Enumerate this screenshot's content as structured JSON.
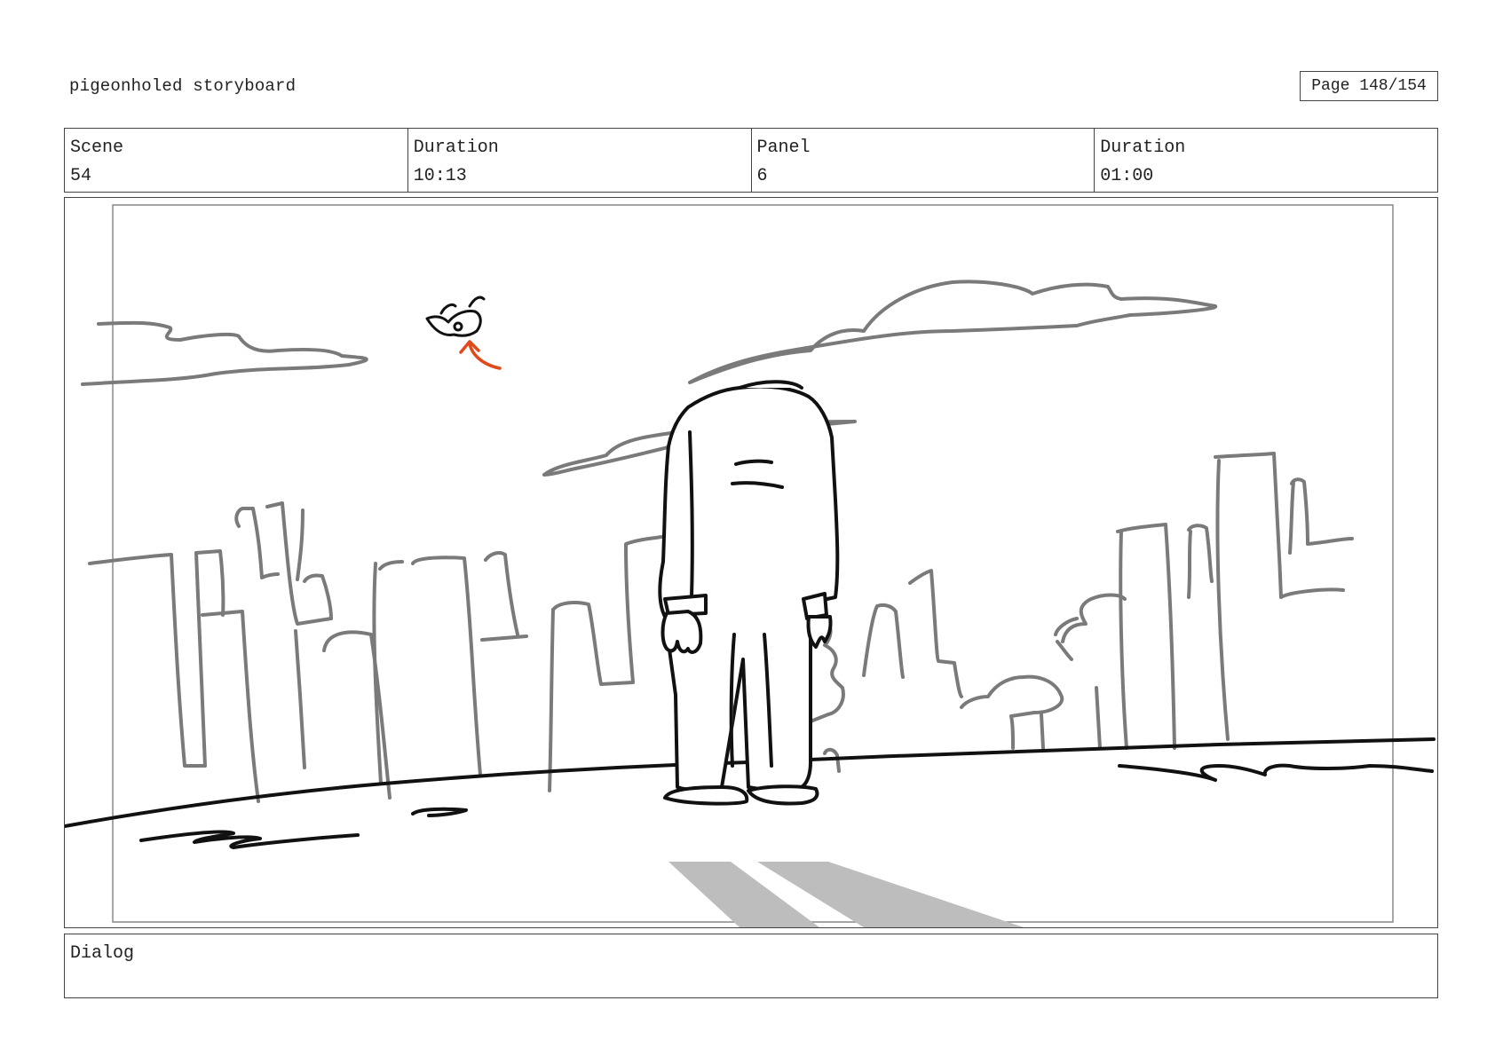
{
  "header": {
    "title": "pigeonholed storyboard",
    "page": "Page 148/154"
  },
  "meta": {
    "scene_label": "Scene",
    "scene_value": "54",
    "scene_duration_label": "Duration",
    "scene_duration_value": "10:13",
    "panel_label": "Panel",
    "panel_value": "6",
    "panel_duration_label": "Duration",
    "panel_duration_value": "01:00"
  },
  "dialog": {
    "label": "Dialog",
    "text": ""
  },
  "colors": {
    "sketch_gray": "#7a7a7a",
    "ink": "#111111",
    "shadow": "#bdbdbd",
    "arrow": "#e04a1a"
  }
}
